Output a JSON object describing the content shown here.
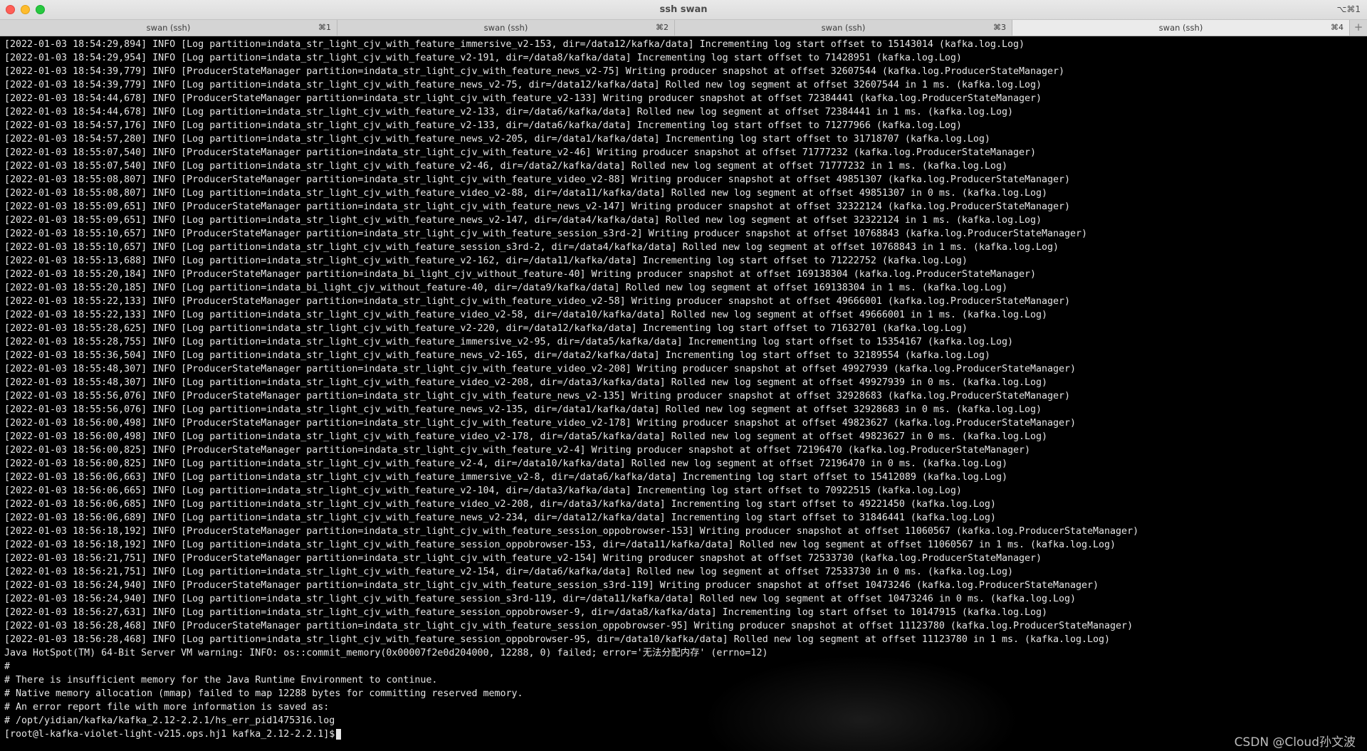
{
  "window": {
    "title": "ssh swan",
    "shortcut": "⌥⌘1"
  },
  "tabs": [
    {
      "label": "swan (ssh)",
      "shortcut": "⌘1",
      "active": false
    },
    {
      "label": "swan (ssh)",
      "shortcut": "⌘2",
      "active": false
    },
    {
      "label": "swan (ssh)",
      "shortcut": "⌘3",
      "active": false
    },
    {
      "label": "swan (ssh)",
      "shortcut": "⌘4",
      "active": true
    }
  ],
  "new_tab_label": "+",
  "terminal": {
    "lines": [
      "[2022-01-03 18:54:29,894] INFO [Log partition=indata_str_light_cjv_with_feature_immersive_v2-153, dir=/data12/kafka/data] Incrementing log start offset to 15143014 (kafka.log.Log)",
      "[2022-01-03 18:54:29,954] INFO [Log partition=indata_str_light_cjv_with_feature_v2-191, dir=/data8/kafka/data] Incrementing log start offset to 71428951 (kafka.log.Log)",
      "[2022-01-03 18:54:39,779] INFO [ProducerStateManager partition=indata_str_light_cjv_with_feature_news_v2-75] Writing producer snapshot at offset 32607544 (kafka.log.ProducerStateManager)",
      "[2022-01-03 18:54:39,779] INFO [Log partition=indata_str_light_cjv_with_feature_news_v2-75, dir=/data12/kafka/data] Rolled new log segment at offset 32607544 in 1 ms. (kafka.log.Log)",
      "[2022-01-03 18:54:44,678] INFO [ProducerStateManager partition=indata_str_light_cjv_with_feature_v2-133] Writing producer snapshot at offset 72384441 (kafka.log.ProducerStateManager)",
      "[2022-01-03 18:54:44,678] INFO [Log partition=indata_str_light_cjv_with_feature_v2-133, dir=/data6/kafka/data] Rolled new log segment at offset 72384441 in 1 ms. (kafka.log.Log)",
      "[2022-01-03 18:54:57,176] INFO [Log partition=indata_str_light_cjv_with_feature_v2-133, dir=/data6/kafka/data] Incrementing log start offset to 71277966 (kafka.log.Log)",
      "[2022-01-03 18:54:57,280] INFO [Log partition=indata_str_light_cjv_with_feature_news_v2-205, dir=/data1/kafka/data] Incrementing log start offset to 31718707 (kafka.log.Log)",
      "[2022-01-03 18:55:07,540] INFO [ProducerStateManager partition=indata_str_light_cjv_with_feature_v2-46] Writing producer snapshot at offset 71777232 (kafka.log.ProducerStateManager)",
      "[2022-01-03 18:55:07,540] INFO [Log partition=indata_str_light_cjv_with_feature_v2-46, dir=/data2/kafka/data] Rolled new log segment at offset 71777232 in 1 ms. (kafka.log.Log)",
      "[2022-01-03 18:55:08,807] INFO [ProducerStateManager partition=indata_str_light_cjv_with_feature_video_v2-88] Writing producer snapshot at offset 49851307 (kafka.log.ProducerStateManager)",
      "[2022-01-03 18:55:08,807] INFO [Log partition=indata_str_light_cjv_with_feature_video_v2-88, dir=/data11/kafka/data] Rolled new log segment at offset 49851307 in 0 ms. (kafka.log.Log)",
      "[2022-01-03 18:55:09,651] INFO [ProducerStateManager partition=indata_str_light_cjv_with_feature_news_v2-147] Writing producer snapshot at offset 32322124 (kafka.log.ProducerStateManager)",
      "[2022-01-03 18:55:09,651] INFO [Log partition=indata_str_light_cjv_with_feature_news_v2-147, dir=/data4/kafka/data] Rolled new log segment at offset 32322124 in 1 ms. (kafka.log.Log)",
      "[2022-01-03 18:55:10,657] INFO [ProducerStateManager partition=indata_str_light_cjv_with_feature_session_s3rd-2] Writing producer snapshot at offset 10768843 (kafka.log.ProducerStateManager)",
      "[2022-01-03 18:55:10,657] INFO [Log partition=indata_str_light_cjv_with_feature_session_s3rd-2, dir=/data4/kafka/data] Rolled new log segment at offset 10768843 in 1 ms. (kafka.log.Log)",
      "[2022-01-03 18:55:13,688] INFO [Log partition=indata_str_light_cjv_with_feature_v2-162, dir=/data11/kafka/data] Incrementing log start offset to 71222752 (kafka.log.Log)",
      "[2022-01-03 18:55:20,184] INFO [ProducerStateManager partition=indata_bi_light_cjv_without_feature-40] Writing producer snapshot at offset 169138304 (kafka.log.ProducerStateManager)",
      "[2022-01-03 18:55:20,185] INFO [Log partition=indata_bi_light_cjv_without_feature-40, dir=/data9/kafka/data] Rolled new log segment at offset 169138304 in 1 ms. (kafka.log.Log)",
      "[2022-01-03 18:55:22,133] INFO [ProducerStateManager partition=indata_str_light_cjv_with_feature_video_v2-58] Writing producer snapshot at offset 49666001 (kafka.log.ProducerStateManager)",
      "[2022-01-03 18:55:22,133] INFO [Log partition=indata_str_light_cjv_with_feature_video_v2-58, dir=/data10/kafka/data] Rolled new log segment at offset 49666001 in 1 ms. (kafka.log.Log)",
      "[2022-01-03 18:55:28,625] INFO [Log partition=indata_str_light_cjv_with_feature_v2-220, dir=/data12/kafka/data] Incrementing log start offset to 71632701 (kafka.log.Log)",
      "[2022-01-03 18:55:28,755] INFO [Log partition=indata_str_light_cjv_with_feature_immersive_v2-95, dir=/data5/kafka/data] Incrementing log start offset to 15354167 (kafka.log.Log)",
      "[2022-01-03 18:55:36,504] INFO [Log partition=indata_str_light_cjv_with_feature_news_v2-165, dir=/data2/kafka/data] Incrementing log start offset to 32189554 (kafka.log.Log)",
      "[2022-01-03 18:55:48,307] INFO [ProducerStateManager partition=indata_str_light_cjv_with_feature_video_v2-208] Writing producer snapshot at offset 49927939 (kafka.log.ProducerStateManager)",
      "[2022-01-03 18:55:48,307] INFO [Log partition=indata_str_light_cjv_with_feature_video_v2-208, dir=/data3/kafka/data] Rolled new log segment at offset 49927939 in 0 ms. (kafka.log.Log)",
      "[2022-01-03 18:55:56,076] INFO [ProducerStateManager partition=indata_str_light_cjv_with_feature_news_v2-135] Writing producer snapshot at offset 32928683 (kafka.log.ProducerStateManager)",
      "[2022-01-03 18:55:56,076] INFO [Log partition=indata_str_light_cjv_with_feature_news_v2-135, dir=/data1/kafka/data] Rolled new log segment at offset 32928683 in 0 ms. (kafka.log.Log)",
      "[2022-01-03 18:56:00,498] INFO [ProducerStateManager partition=indata_str_light_cjv_with_feature_video_v2-178] Writing producer snapshot at offset 49823627 (kafka.log.ProducerStateManager)",
      "[2022-01-03 18:56:00,498] INFO [Log partition=indata_str_light_cjv_with_feature_video_v2-178, dir=/data5/kafka/data] Rolled new log segment at offset 49823627 in 0 ms. (kafka.log.Log)",
      "[2022-01-03 18:56:00,825] INFO [ProducerStateManager partition=indata_str_light_cjv_with_feature_v2-4] Writing producer snapshot at offset 72196470 (kafka.log.ProducerStateManager)",
      "[2022-01-03 18:56:00,825] INFO [Log partition=indata_str_light_cjv_with_feature_v2-4, dir=/data10/kafka/data] Rolled new log segment at offset 72196470 in 0 ms. (kafka.log.Log)",
      "[2022-01-03 18:56:06,663] INFO [Log partition=indata_str_light_cjv_with_feature_immersive_v2-8, dir=/data6/kafka/data] Incrementing log start offset to 15412089 (kafka.log.Log)",
      "[2022-01-03 18:56:06,665] INFO [Log partition=indata_str_light_cjv_with_feature_v2-104, dir=/data3/kafka/data] Incrementing log start offset to 70922515 (kafka.log.Log)",
      "[2022-01-03 18:56:06,685] INFO [Log partition=indata_str_light_cjv_with_feature_video_v2-208, dir=/data3/kafka/data] Incrementing log start offset to 49221450 (kafka.log.Log)",
      "[2022-01-03 18:56:06,689] INFO [Log partition=indata_str_light_cjv_with_feature_news_v2-234, dir=/data12/kafka/data] Incrementing log start offset to 31846441 (kafka.log.Log)",
      "[2022-01-03 18:56:18,192] INFO [ProducerStateManager partition=indata_str_light_cjv_with_feature_session_oppobrowser-153] Writing producer snapshot at offset 11060567 (kafka.log.ProducerStateManager)",
      "[2022-01-03 18:56:18,192] INFO [Log partition=indata_str_light_cjv_with_feature_session_oppobrowser-153, dir=/data11/kafka/data] Rolled new log segment at offset 11060567 in 1 ms. (kafka.log.Log)",
      "[2022-01-03 18:56:21,751] INFO [ProducerStateManager partition=indata_str_light_cjv_with_feature_v2-154] Writing producer snapshot at offset 72533730 (kafka.log.ProducerStateManager)",
      "[2022-01-03 18:56:21,751] INFO [Log partition=indata_str_light_cjv_with_feature_v2-154, dir=/data6/kafka/data] Rolled new log segment at offset 72533730 in 0 ms. (kafka.log.Log)",
      "[2022-01-03 18:56:24,940] INFO [ProducerStateManager partition=indata_str_light_cjv_with_feature_session_s3rd-119] Writing producer snapshot at offset 10473246 (kafka.log.ProducerStateManager)",
      "[2022-01-03 18:56:24,940] INFO [Log partition=indata_str_light_cjv_with_feature_session_s3rd-119, dir=/data11/kafka/data] Rolled new log segment at offset 10473246 in 0 ms. (kafka.log.Log)",
      "[2022-01-03 18:56:27,631] INFO [Log partition=indata_str_light_cjv_with_feature_session_oppobrowser-9, dir=/data8/kafka/data] Incrementing log start offset to 10147915 (kafka.log.Log)",
      "[2022-01-03 18:56:28,468] INFO [ProducerStateManager partition=indata_str_light_cjv_with_feature_session_oppobrowser-95] Writing producer snapshot at offset 11123780 (kafka.log.ProducerStateManager)",
      "[2022-01-03 18:56:28,468] INFO [Log partition=indata_str_light_cjv_with_feature_session_oppobrowser-95, dir=/data10/kafka/data] Rolled new log segment at offset 11123780 in 1 ms. (kafka.log.Log)",
      "Java HotSpot(TM) 64-Bit Server VM warning: INFO: os::commit_memory(0x00007f2e0d204000, 12288, 0) failed; error='无法分配内存' (errno=12)",
      "#",
      "# There is insufficient memory for the Java Runtime Environment to continue.",
      "# Native memory allocation (mmap) failed to map 12288 bytes for committing reserved memory.",
      "# An error report file with more information is saved as:",
      "# /opt/yidian/kafka/kafka_2.12-2.2.1/hs_err_pid1475316.log"
    ],
    "prompt": "[root@l-kafka-violet-light-v215.ops.hj1 kafka_2.12-2.2.1]$"
  },
  "watermark": "CSDN @Cloud孙文波",
  "colors": {
    "terminal_bg": "#000000",
    "terminal_fg": "#e6e6e6",
    "close": "#ff5f57",
    "minimize": "#febc2e",
    "maximize": "#28c840"
  }
}
